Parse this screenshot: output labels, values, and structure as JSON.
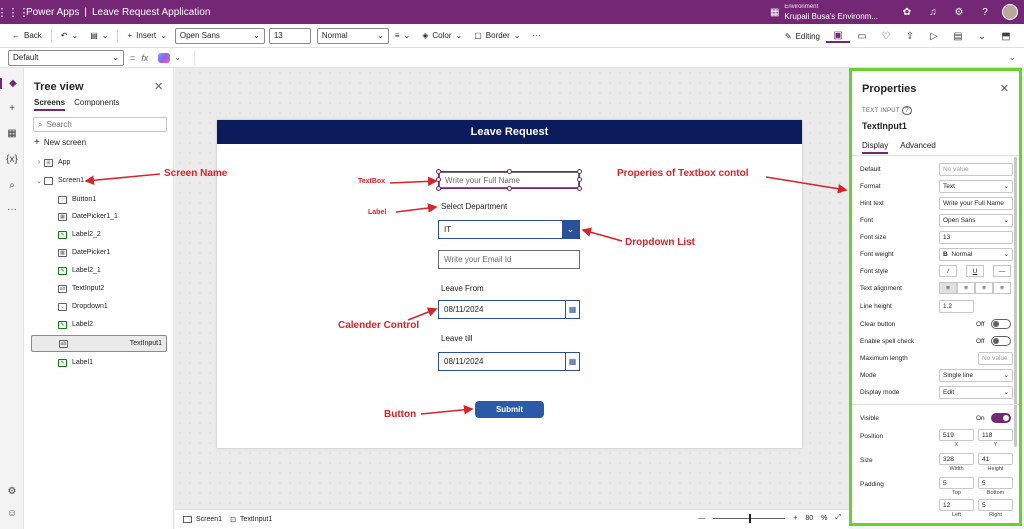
{
  "titlebar": {
    "app": "Power Apps",
    "separator": "|",
    "project": "Leave Request Application",
    "env_label": "Environment",
    "env_name": "Krupali Busa's Environm..."
  },
  "command_bar": {
    "back": "Back",
    "insert": "Insert",
    "font": "Open Sans",
    "font_size": "13",
    "weight": "Normal",
    "color": "Color",
    "border": "Border",
    "more": "···",
    "editing": "Editing"
  },
  "formula_bar": {
    "property": "Default",
    "equals": "=",
    "fx": "fx"
  },
  "tree": {
    "title": "Tree view",
    "tabs": [
      "Screens",
      "Components"
    ],
    "search_placeholder": "Search",
    "new_screen": "New screen",
    "app": "App",
    "screen": "Screen1",
    "children": [
      "Button1",
      "DatePicker1_1",
      "Label2_2",
      "DatePicker1",
      "Label2_1",
      "TextInput2",
      "Dropdown1",
      "Label2",
      "TextInput1",
      "Label1"
    ],
    "selected": "TextInput1",
    "more": "···"
  },
  "form": {
    "header": "Leave Request",
    "name_placeholder": "Write your Full Name",
    "dept_label": "Select Department",
    "dept_value": "IT",
    "email_placeholder": "Write your Email Id",
    "from_label": "Leave From",
    "from_value": "08/11/2024",
    "till_label": "Leave till",
    "till_value": "08/11/2024",
    "submit": "Submit"
  },
  "annotations": {
    "screen_name": "Screen Name",
    "textbox": "TextBox",
    "label": "Label",
    "properties": "Properies of Textbox contol",
    "dropdown": "Dropdown List",
    "calendar": "Calender Control",
    "button": "Button"
  },
  "statusbar": {
    "screen": "Screen1",
    "control": "TextInput1",
    "minus": "—",
    "plus": "+",
    "zoom": "80",
    "zoom_unit": "%"
  },
  "properties": {
    "title": "Properties",
    "type": "TEXT INPUT",
    "name": "TextInput1",
    "tabs": [
      "Display",
      "Advanced"
    ],
    "default_label": "Default",
    "default_ph": "No value",
    "format_label": "Format",
    "format": "Text",
    "hint_label": "Hint text",
    "hint": "Write your Full Name",
    "font_label": "Font",
    "font": "Open Sans",
    "size_label": "Font size",
    "size": "13",
    "weight_label": "Font weight",
    "weight": "Normal",
    "weight_glyph": "B",
    "style_label": "Font style",
    "style_i": "/",
    "style_u": "U",
    "style_s": "—",
    "align_label": "Text alignment",
    "lineh_label": "Line height",
    "lineh": "1.2",
    "clear_label": "Clear button",
    "clear_state": "Off",
    "spell_label": "Enable spell check",
    "spell_state": "Off",
    "maxlen_label": "Maximum length",
    "maxlen_ph": "No value",
    "mode_label": "Mode",
    "mode": "Single line",
    "dmode_label": "Display mode",
    "dmode": "Edit",
    "visible_label": "Visible",
    "visible_state": "On",
    "position_label": "Position",
    "pos_x": "519",
    "pos_y": "118",
    "cap_x": "X",
    "cap_y": "Y",
    "size2_label": "Size",
    "width": "328",
    "height": "41",
    "cap_w": "Width",
    "cap_h": "Height",
    "padding_label": "Padding",
    "pad_top": "5",
    "pad_bottom": "5",
    "pad_left": "12",
    "pad_right": "5",
    "cap_top": "Top",
    "cap_bottom": "Bottom",
    "cap_left": "Left",
    "cap_right": "Right"
  },
  "colors": {
    "brand": "#742774",
    "header": "#0b1b5c",
    "accent": "#2a4f9b",
    "annotation": "#d8232a",
    "highlight": "#66d22d"
  }
}
